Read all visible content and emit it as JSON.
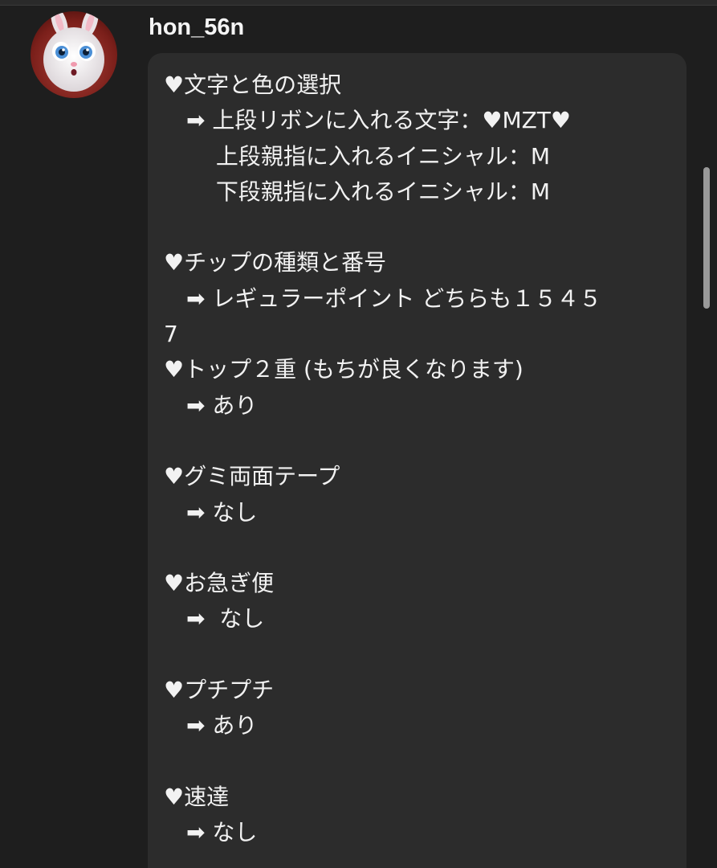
{
  "username": "hon_56n",
  "avatar_icon": "bunny-avatar-icon",
  "message_lines": [
    "♥文字と色の選択",
    "　➡ 上段リボンに入れる文字：♥MZT♥",
    "　　 上段親指に入れるイニシャル：M",
    "　　 下段親指に入れるイニシャル：M",
    "",
    "♥チップの種類と番号",
    "　➡ レギュラーポイント どちらも１５４５",
    "7",
    "♥トップ２重 (もちが良くなります)",
    "　➡ あり",
    "",
    "♥グミ両面テープ",
    "　➡ なし",
    "",
    "♥お急ぎ便",
    "　➡  なし",
    "",
    "♥プチプチ",
    "　➡ あり",
    "",
    "♥速達",
    "　➡ なし"
  ],
  "colors": {
    "background": "#1e1e1e",
    "bubble": "#2c2c2c",
    "text": "#f2f2f2"
  }
}
